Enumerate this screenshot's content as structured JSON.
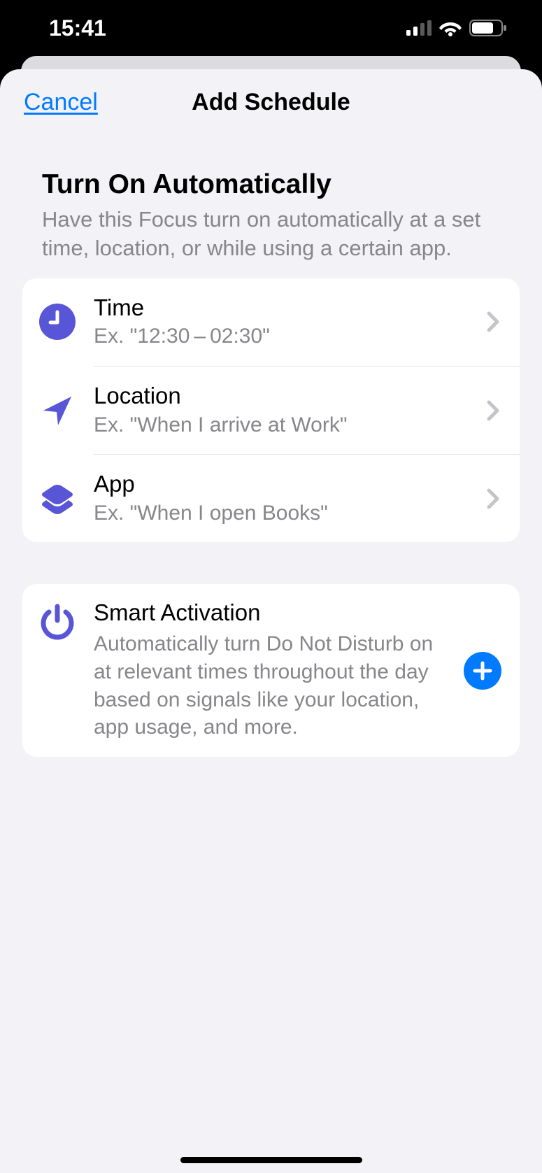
{
  "status": {
    "time": "15:41"
  },
  "nav": {
    "cancel": "Cancel",
    "title": "Add Schedule"
  },
  "section": {
    "title": "Turn On Automatically",
    "desc": "Have this Focus turn on automatically at a set time, location, or while using a certain app."
  },
  "rows": {
    "time": {
      "title": "Time",
      "sub": "Ex. \"12:30 – 02:30\""
    },
    "location": {
      "title": "Location",
      "sub": "Ex. \"When I arrive at Work\""
    },
    "app": {
      "title": "App",
      "sub": "Ex. \"When I open Books\""
    }
  },
  "smart": {
    "title": "Smart Activation",
    "desc": "Automatically turn Do Not Disturb on at relevant times throughout the day based on signals like your location, app usage, and more."
  }
}
